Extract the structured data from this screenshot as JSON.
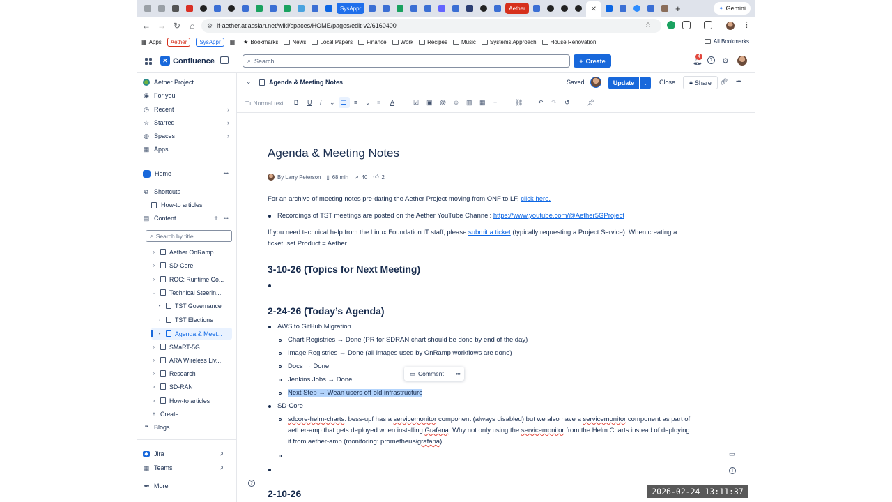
{
  "browser": {
    "tab_pills": [
      "SysAppr",
      "Aether"
    ],
    "gemini_label": "Gemini",
    "url": "lf-aether.atlassian.net/wiki/spaces/HOME/pages/edit-v2/6160400",
    "bookmarks": {
      "apps": "Apps",
      "pill_aether": "Aether",
      "pill_sysappr": "SysAppr",
      "items": [
        "Bookmarks",
        "News",
        "Local Papers",
        "Finance",
        "Work",
        "Recipes",
        "Music",
        "Systems Approach",
        "House Renovation"
      ],
      "all": "All Bookmarks"
    }
  },
  "header": {
    "product": "Confluence",
    "search_placeholder": "Search",
    "create_label": "Create",
    "notification_count": "4"
  },
  "sidebar": {
    "top_items": [
      "Aether Project",
      "For you",
      "Recent",
      "Starred",
      "Spaces",
      "Apps"
    ],
    "home": "Home",
    "shortcuts": "Shortcuts",
    "howto": "How-to articles",
    "content": "Content",
    "search_placeholder": "Search by title",
    "tree": {
      "t1": "Aether OnRamp",
      "t2": "SD-Core",
      "t3": "ROC: Runtime Co...",
      "t4": "Technical Steerin...",
      "t5": "TST Governance",
      "t6": "TST Elections",
      "t7": "Agenda & Meet...",
      "t8": "SMaRT-5G",
      "t9": "ARA Wireless Liv...",
      "t10": "Research",
      "t11": "SD-RAN",
      "t12": "How-to articles"
    },
    "create": "Create",
    "blogs": "Blogs",
    "jira": "Jira",
    "teams": "Teams",
    "more": "More"
  },
  "pagebar": {
    "title": "Agenda & Meeting Notes",
    "saved": "Saved",
    "update": "Update",
    "close": "Close",
    "share": "Share"
  },
  "toolbar": {
    "text_style": "Normal text"
  },
  "page": {
    "title": "Agenda & Meeting Notes",
    "meta": {
      "author": "By Larry Peterson",
      "read_time": "68 min",
      "views": "40",
      "likes": "2"
    },
    "intro": {
      "text": "For an archive of meeting notes pre-dating the Aether Project moving from ONF to LF, ",
      "link": "click here."
    },
    "recordings": {
      "text": "Recordings of TST meetings are posted on the Aether YouTube Channel: ",
      "link": "https://www.youtube.com/@Aether5GProject"
    },
    "help": {
      "before": "If you need technical help from the Linux Foundation IT staff, please ",
      "link": "submit a ticket",
      "after1": " (typically requesting a Project Service). When creating a",
      "after2": "ticket, set Product = Aether."
    },
    "h_next": "3-10-26 (Topics for Next Meeting)",
    "ellipsis": "...",
    "h_today": "2-24-26 (Today’s Agenda)",
    "aws": "AWS to GitHub Migration",
    "chart_reg": "Chart Registries → Done (PR for SDRAN chart should be done by end of the day)",
    "image_reg": "Image Registries → Done (all images used by OnRamp workflows are done)",
    "docs": "Docs → Done",
    "jenkins": "Jenkins Jobs → Done",
    "next_step": "Next Step → Wean users off old infrastructure",
    "sdcore": "SD-Core",
    "sdcore_item": {
      "l1a": "sdcore-helm-charts",
      "l1b": ": bess-upf has a ",
      "l1c": "servicemonitor",
      "l1d": " component (always disabled) but we also have a ",
      "l1e": "servicemonitor",
      "l1f": " component as part of",
      "l2a": "aether-amp that gets deployed when installing ",
      "l2b": "Grafana",
      "l2c": ". Why not only using the ",
      "l2d": "servicemonitor",
      "l2e": " from the Helm Charts instead of deploying",
      "l3a": "it from aether-amp (monitoring: prometheus/",
      "l3b": "grafana",
      "l3c": ")"
    },
    "h_prev": "2-10-26",
    "comment": "Comment"
  },
  "timestamp": "2026-02-24  13:11:37"
}
